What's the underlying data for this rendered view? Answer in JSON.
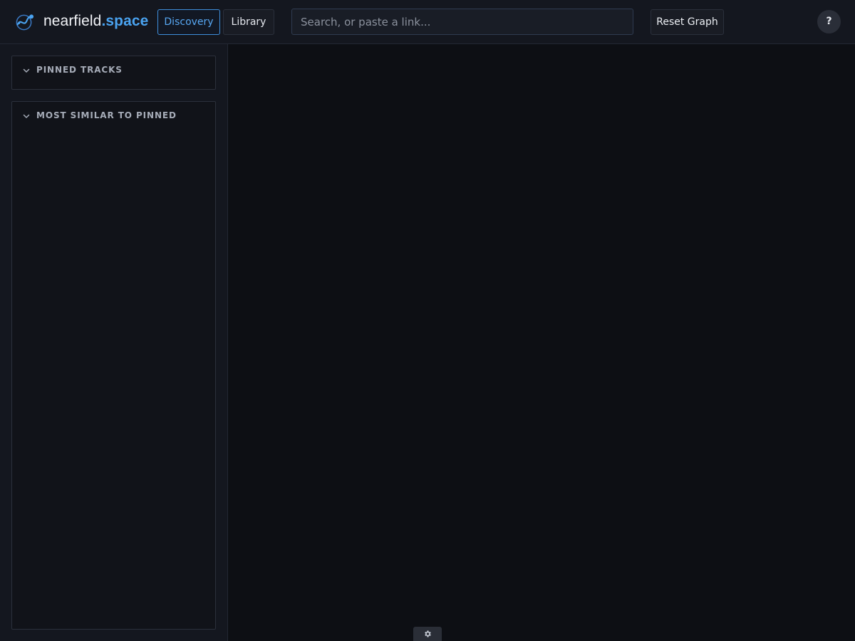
{
  "header": {
    "brand_name": "nearfield",
    "brand_tld": ".space",
    "logo_icon": "node-graph-icon",
    "nav": [
      {
        "label": "Discovery",
        "active": true
      },
      {
        "label": "Library",
        "active": false
      }
    ],
    "search": {
      "placeholder": "Search, or paste a link...",
      "value": ""
    },
    "reset_label": "Reset Graph",
    "help_label": "?"
  },
  "sidebar": {
    "panels": [
      {
        "title": "PINNED TRACKS",
        "expanded": true,
        "icon": "chevron-down-icon"
      },
      {
        "title": "MOST SIMILAR TO PINNED",
        "expanded": true,
        "icon": "chevron-down-icon"
      }
    ]
  },
  "footer": {
    "settings_icon": "gear-icon"
  },
  "colors": {
    "background": "#0e1016",
    "topbar": "#14171f",
    "accent": "#4aa3f0",
    "text": "#e6e9ef",
    "muted": "#a6acb8"
  }
}
